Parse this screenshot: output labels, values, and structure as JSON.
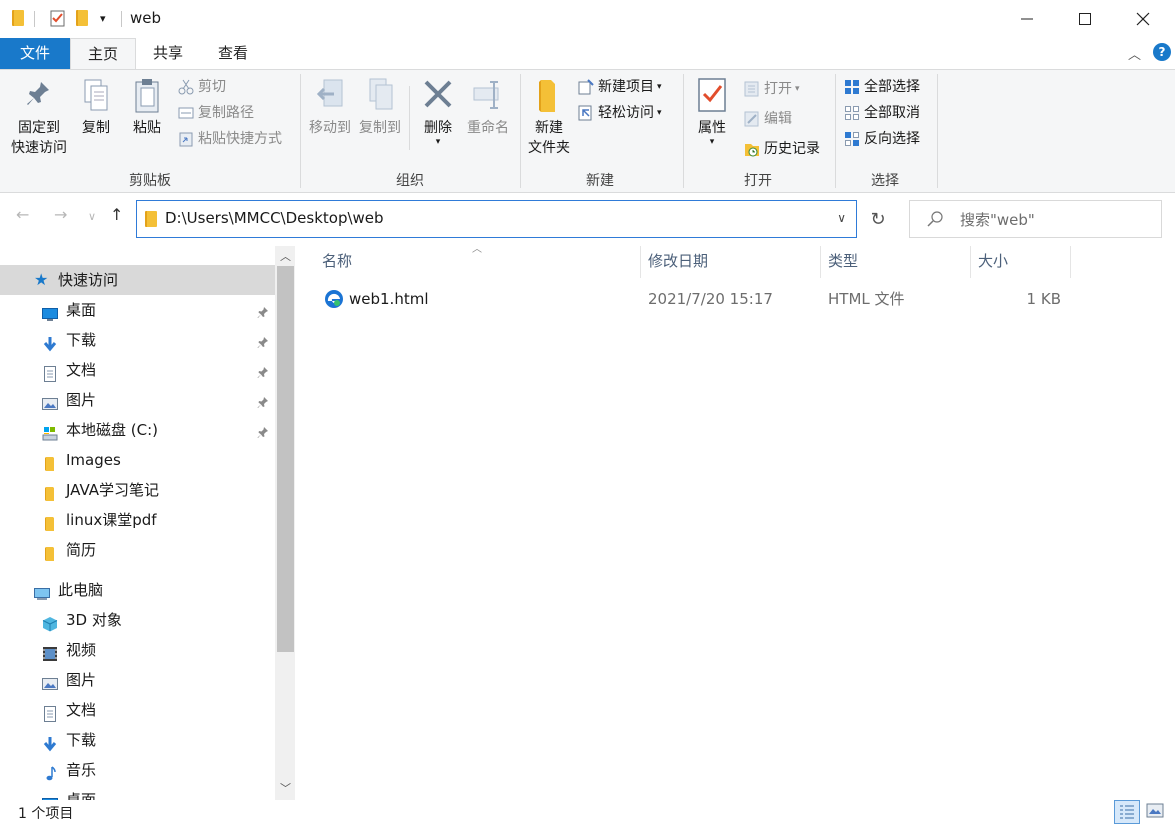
{
  "window": {
    "title": "web"
  },
  "tabs": {
    "file": "文件",
    "home": "主页",
    "share": "共享",
    "view": "查看"
  },
  "ribbon": {
    "clipboard": {
      "label": "剪贴板",
      "pin": "固定到\n快速访问",
      "pin_line1": "固定到",
      "pin_line2": "快速访问",
      "copy": "复制",
      "paste": "粘贴",
      "cut": "剪切",
      "copy_path": "复制路径",
      "paste_shortcut": "粘贴快捷方式"
    },
    "organize": {
      "label": "组织",
      "move_to": "移动到",
      "copy_to": "复制到",
      "delete": "删除",
      "rename": "重命名"
    },
    "new": {
      "label": "新建",
      "new_folder_line1": "新建",
      "new_folder_line2": "文件夹",
      "new_item": "新建项目",
      "easy_access": "轻松访问"
    },
    "open": {
      "label": "打开",
      "properties": "属性",
      "open": "打开",
      "edit": "编辑",
      "history": "历史记录"
    },
    "select": {
      "label": "选择",
      "select_all": "全部选择",
      "select_none": "全部取消",
      "invert": "反向选择"
    }
  },
  "address": {
    "path": "D:\\Users\\MMCC\\Desktop\\web"
  },
  "search": {
    "placeholder": "搜索\"web\""
  },
  "nav": {
    "quick_access": "快速访问",
    "items": [
      {
        "label": "桌面",
        "icon": "desktop-icon",
        "pinned": true
      },
      {
        "label": "下载",
        "icon": "download-icon",
        "pinned": true
      },
      {
        "label": "文档",
        "icon": "document-icon",
        "pinned": true
      },
      {
        "label": "图片",
        "icon": "pictures-icon",
        "pinned": true
      },
      {
        "label": "本地磁盘 (C:)",
        "icon": "drive-icon",
        "pinned": true
      },
      {
        "label": "Images",
        "icon": "folder-icon",
        "pinned": false
      },
      {
        "label": "JAVA学习笔记",
        "icon": "folder-icon",
        "pinned": false
      },
      {
        "label": "linux课堂pdf",
        "icon": "folder-icon",
        "pinned": false
      },
      {
        "label": "简历",
        "icon": "folder-icon",
        "pinned": false
      }
    ],
    "this_pc": "此电脑",
    "pc_items": [
      {
        "label": "3D 对象",
        "icon": "3d-objects-icon"
      },
      {
        "label": "视频",
        "icon": "video-icon"
      },
      {
        "label": "图片",
        "icon": "pictures-icon"
      },
      {
        "label": "文档",
        "icon": "document-icon"
      },
      {
        "label": "下载",
        "icon": "download-icon"
      },
      {
        "label": "音乐",
        "icon": "music-icon"
      },
      {
        "label": "桌面",
        "icon": "desktop-icon"
      }
    ]
  },
  "columns": {
    "name": "名称",
    "modified": "修改日期",
    "type": "类型",
    "size": "大小"
  },
  "files": [
    {
      "name": "web1.html",
      "modified": "2021/7/20 15:17",
      "type": "HTML 文件",
      "size": "1 KB",
      "icon": "edge-html-icon"
    }
  ],
  "status": {
    "item_count": "1 个项目"
  },
  "colors": {
    "accent": "#1979ca",
    "folder": "#f4c037",
    "selection": "#cce8ff"
  }
}
